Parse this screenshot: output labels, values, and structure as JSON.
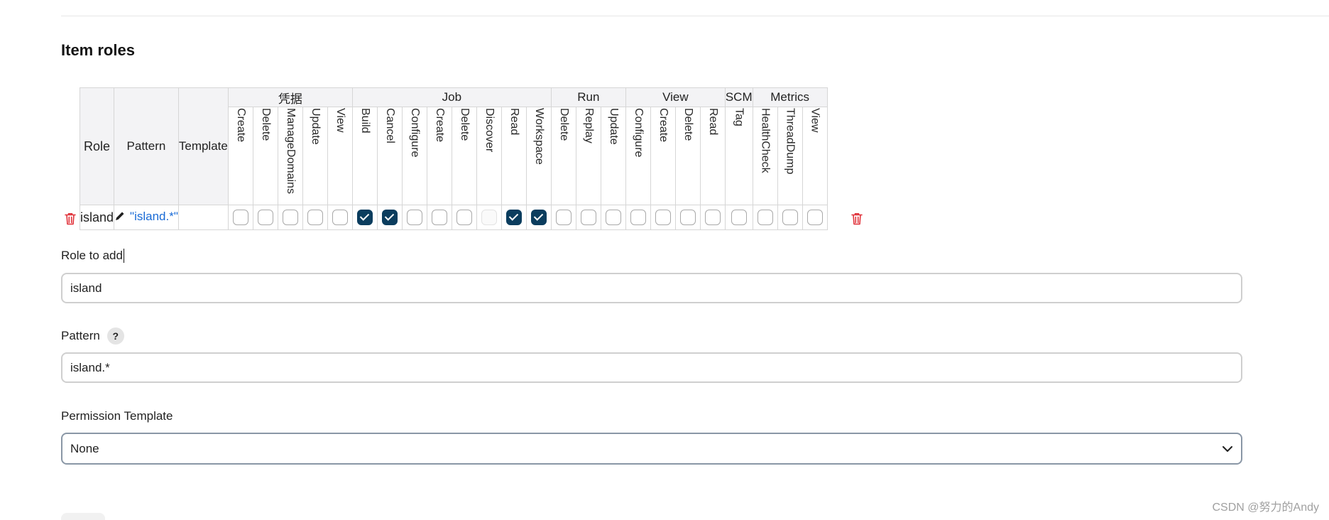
{
  "section": {
    "title": "Item roles"
  },
  "table": {
    "headers": {
      "role": "Role",
      "pattern": "Pattern",
      "template": "Template"
    },
    "groups": [
      {
        "name": "凭据",
        "permissions": [
          "Create",
          "Delete",
          "ManageDomains",
          "Update",
          "View"
        ]
      },
      {
        "name": "Job",
        "permissions": [
          "Build",
          "Cancel",
          "Configure",
          "Create",
          "Delete",
          "Discover",
          "Read",
          "Workspace"
        ]
      },
      {
        "name": "Run",
        "permissions": [
          "Delete",
          "Replay",
          "Update"
        ]
      },
      {
        "name": "View",
        "permissions": [
          "Configure",
          "Create",
          "Delete",
          "Read"
        ]
      },
      {
        "name": "SCM",
        "permissions": [
          "Tag"
        ]
      },
      {
        "name": "Metrics",
        "permissions": [
          "HealthCheck",
          "ThreadDump",
          "View"
        ]
      }
    ],
    "rows": [
      {
        "role": "island",
        "pattern": "\"island.*\"",
        "template": "",
        "checked": [
          false,
          false,
          false,
          false,
          false,
          true,
          true,
          false,
          false,
          false,
          "disabled",
          true,
          true,
          false,
          false,
          false,
          false,
          false,
          false,
          false,
          false,
          false,
          false,
          false
        ]
      }
    ]
  },
  "form": {
    "role_to_add": {
      "label": "Role to add",
      "value": "island"
    },
    "pattern": {
      "label": "Pattern",
      "help": "?",
      "value": "island.*"
    },
    "permission_template": {
      "label": "Permission Template",
      "selected": "None"
    }
  },
  "watermark": "CSDN @努力的Andy",
  "colors": {
    "checkbox_checked": "#0b3d5e",
    "link": "#1a6bd6",
    "delete_icon": "#e0323a"
  }
}
